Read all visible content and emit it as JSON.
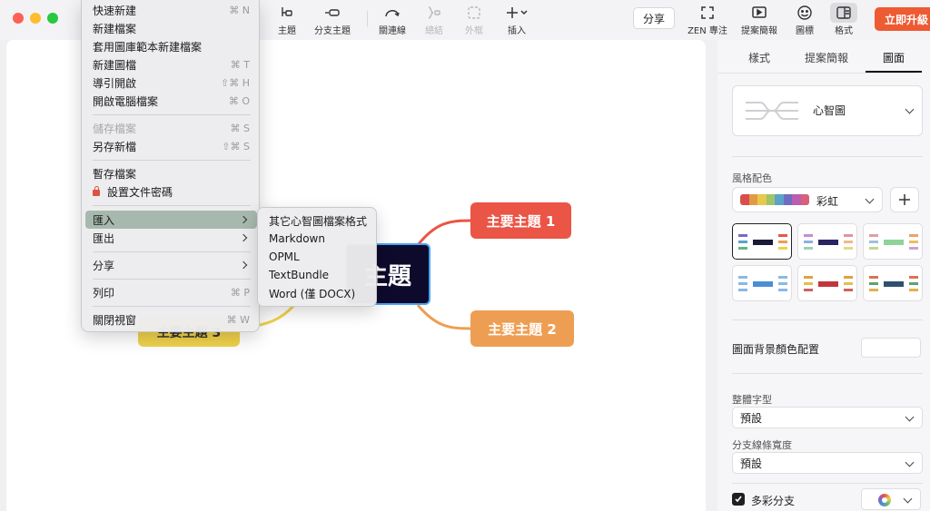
{
  "toolbar": {
    "tools": [
      {
        "label": "主題",
        "icon": "topic-icon"
      },
      {
        "label": "分支主題",
        "icon": "subtopic-icon"
      },
      {
        "label": "關連線",
        "icon": "relationship-icon"
      },
      {
        "label": "總結",
        "icon": "summary-icon"
      },
      {
        "label": "外框",
        "icon": "boundary-icon"
      },
      {
        "label": "插入",
        "icon": "insert-icon"
      }
    ],
    "share": "分享",
    "right_tools": [
      {
        "label": "ZEN 專注",
        "icon": "zen-icon"
      },
      {
        "label": "提案簡報",
        "icon": "pitch-icon"
      },
      {
        "label": "圖標",
        "icon": "sticker-icon"
      },
      {
        "label": "格式",
        "icon": "format-icon"
      }
    ],
    "upgrade": "立即升級"
  },
  "menu": {
    "items": [
      {
        "label": "快速新建",
        "shortcut": "⌘ N"
      },
      {
        "label": "新建檔案",
        "shortcut": ""
      },
      {
        "label": "套用圖庫範本新建檔案",
        "shortcut": ""
      },
      {
        "label": "新建圖檔",
        "shortcut": "⌘ T"
      },
      {
        "label": "導引開啟",
        "shortcut": "⇧⌘ H"
      },
      {
        "label": "開啟電腦檔案",
        "shortcut": "⌘ O"
      },
      {
        "label": "儲存檔案",
        "shortcut": "⌘ S"
      },
      {
        "label": "另存新檔",
        "shortcut": "⇧⌘ S"
      },
      {
        "label": "暫存檔案",
        "shortcut": ""
      },
      {
        "label": "設置文件密碼",
        "shortcut": ""
      },
      {
        "label": "匯入",
        "shortcut": ""
      },
      {
        "label": "匯出",
        "shortcut": ""
      },
      {
        "label": "分享",
        "shortcut": ""
      },
      {
        "label": "列印",
        "shortcut": "⌘ P"
      },
      {
        "label": "關閉視窗",
        "shortcut": "⌘ W"
      }
    ]
  },
  "submenu": {
    "items": [
      "其它心智圖檔案格式",
      "Markdown",
      "OPML",
      "TextBundle",
      "Word (僅 DOCX)"
    ]
  },
  "canvas": {
    "central": "主題",
    "topic1": "主要主題 1",
    "topic2": "主要主題 2",
    "topic3": "主要主題 3",
    "colors": {
      "topic1": "#ea5545",
      "topic2": "#ee9e53",
      "topic3": "#f0d24b",
      "central": "#0d0a2b"
    }
  },
  "sidebar": {
    "tabs": [
      "樣式",
      "提案簡報",
      "圖面"
    ],
    "structure": "心智圖",
    "color_theme_label": "風格配色",
    "color_theme": "彩虹",
    "bg_label": "圖面背景顏色配置",
    "font_label": "整體字型",
    "font_value": "預設",
    "branch_width_label": "分支線條寬度",
    "branch_width_value": "預設",
    "rainbow_branch": "多彩分支"
  }
}
